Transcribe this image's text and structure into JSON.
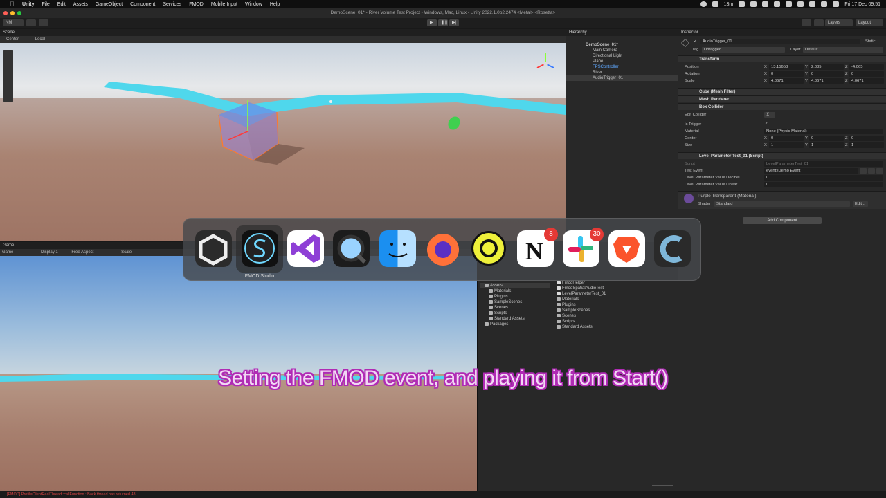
{
  "menubar": {
    "app": "Unity",
    "items": [
      "File",
      "Edit",
      "Assets",
      "GameObject",
      "Component",
      "Services",
      "FMOD",
      "Mobile Input",
      "Window",
      "Help"
    ],
    "status_time_left": "13m",
    "datetime": "Fri 17 Dec  09.51"
  },
  "window": {
    "title": "DemoScene_01* - River Volume Test Project - Windows, Mac, Linux - Unity 2022.1.0b2.2474 <Metal> <Rosetta>"
  },
  "toolbar": {
    "account": "NM",
    "layers": "Layers",
    "layout": "Layout"
  },
  "scene": {
    "tab": "Scene",
    "pivot": "Center",
    "space": "Local"
  },
  "game": {
    "tab": "Game",
    "mode": "Game",
    "display": "Display 1",
    "aspect": "Free Aspect",
    "scale": "Scale"
  },
  "hierarchy": {
    "tab": "Hierarchy",
    "scene_name": "DemoScene_01*",
    "items": [
      "Main Camera",
      "Directional Light",
      "Plane",
      "FPSController",
      "River",
      "AudioTrigger_01"
    ]
  },
  "project": {
    "tree": [
      "Assets",
      "Materials",
      "Plugins",
      "SampleScenes",
      "Scenes",
      "Scripts",
      "Standard Assets",
      "Packages"
    ],
    "files": [
      "FmodHelper",
      "FmodSpatialAudioTest",
      "LevelParameterTest_01",
      "Materials",
      "Plugins",
      "SampleScenes",
      "Scenes",
      "Scripts",
      "Standard Assets"
    ]
  },
  "inspector": {
    "tab": "Inspector",
    "object_name": "AudioTrigger_01",
    "static_label": "Static",
    "tag_label": "Tag",
    "tag_value": "Untagged",
    "layer_label": "Layer",
    "layer_value": "Default",
    "transform": {
      "title": "Transform",
      "position_label": "Position",
      "position": [
        "13.15658",
        "2.035",
        "-4.065"
      ],
      "rotation_label": "Rotation",
      "rotation": [
        "0",
        "0",
        "0"
      ],
      "scale_label": "Scale",
      "scale": [
        "4.0671",
        "4.0671",
        "4.0671"
      ]
    },
    "mesh_filter": "Cube (Mesh Filter)",
    "mesh_renderer": "Mesh Renderer",
    "box_collider": {
      "title": "Box Collider",
      "edit_label": "Edit Collider",
      "is_trigger_label": "Is Trigger",
      "material_label": "Material",
      "material_value": "None (Physic Material)",
      "center_label": "Center",
      "center": [
        "0",
        "0",
        "0"
      ],
      "size_label": "Size",
      "size": [
        "1",
        "1",
        "1"
      ]
    },
    "script": {
      "title": "Level Parameter Test_01 (Script)",
      "script_label": "Script",
      "script_value": "LevelParameterTest_01",
      "event_label": "Test Event",
      "event_value": "event:/Demo Event",
      "decibel_label": "Level Parameter Value Decibel",
      "decibel_value": "0",
      "linear_label": "Level Parameter Value Linear",
      "linear_value": "0"
    },
    "material": {
      "title": "Purple Transparent (Material)",
      "shader_label": "Shader",
      "shader_value": "Standard",
      "edit": "Edit..."
    },
    "add_component": "Add Component"
  },
  "status": "[FMOD] ProfileClientRealThread::callFunction : Back thread has returned 43",
  "dock": {
    "caption": "FMOD Studio",
    "apps": [
      "unity-icon",
      "fmod-studio-icon",
      "visual-studio-icon",
      "quicktime-icon",
      "finder-icon",
      "firefox-icon",
      "circle-app-icon",
      "notion-icon",
      "slack-icon",
      "brave-icon",
      "clion-icon"
    ],
    "badges": {
      "notion": "8",
      "slack": "30"
    }
  },
  "subtitle": "Setting the FMOD event, and playing it from Start()",
  "colors": {
    "river": "#4fd7ec",
    "subtitle_outline": "#b02bb5",
    "unity_bg": "#282828"
  }
}
